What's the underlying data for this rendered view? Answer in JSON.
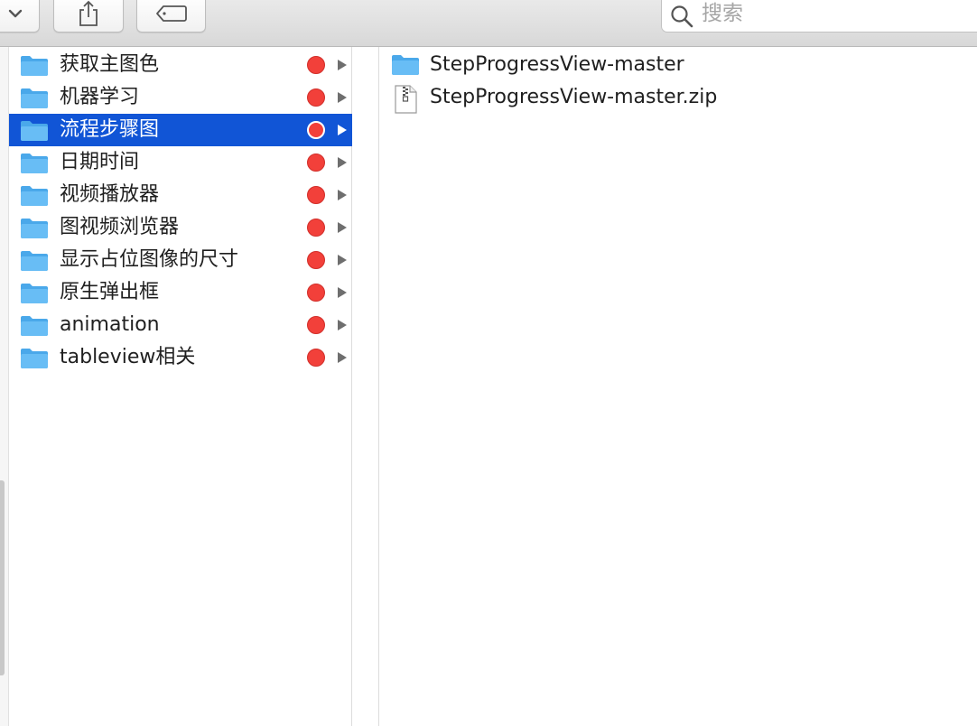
{
  "toolbar": {
    "view_button": {
      "icon": "chevron-down-icon"
    },
    "share_button": {
      "icon": "share-icon"
    },
    "tags_button": {
      "icon": "tag-icon"
    },
    "search": {
      "placeholder": "搜索",
      "value": ""
    }
  },
  "sidebar_column": {
    "items": [
      {
        "label": "获取主图色",
        "tag_color": "#f2403a",
        "selected": false
      },
      {
        "label": "机器学习",
        "tag_color": "#f2403a",
        "selected": false
      },
      {
        "label": "流程步骤图",
        "tag_color": "#f2403a",
        "selected": true
      },
      {
        "label": "日期时间",
        "tag_color": "#f2403a",
        "selected": false
      },
      {
        "label": "视频播放器",
        "tag_color": "#f2403a",
        "selected": false
      },
      {
        "label": "图视频浏览器",
        "tag_color": "#f2403a",
        "selected": false
      },
      {
        "label": "显示占位图像的尺寸",
        "tag_color": "#f2403a",
        "selected": false
      },
      {
        "label": "原生弹出框",
        "tag_color": "#f2403a",
        "selected": false
      },
      {
        "label": "animation",
        "tag_color": "#f2403a",
        "selected": false
      },
      {
        "label": "tableview相关",
        "tag_color": "#f2403a",
        "selected": false
      }
    ]
  },
  "contents_column": {
    "items": [
      {
        "label": "StepProgressView-master",
        "icon": "folder-icon"
      },
      {
        "label": "StepProgressView-master.zip",
        "icon": "zip-file-icon"
      }
    ]
  },
  "colors": {
    "selection": "#1155d6",
    "tag_red": "#f2403a",
    "folder_blue": "#5fb8f3"
  }
}
